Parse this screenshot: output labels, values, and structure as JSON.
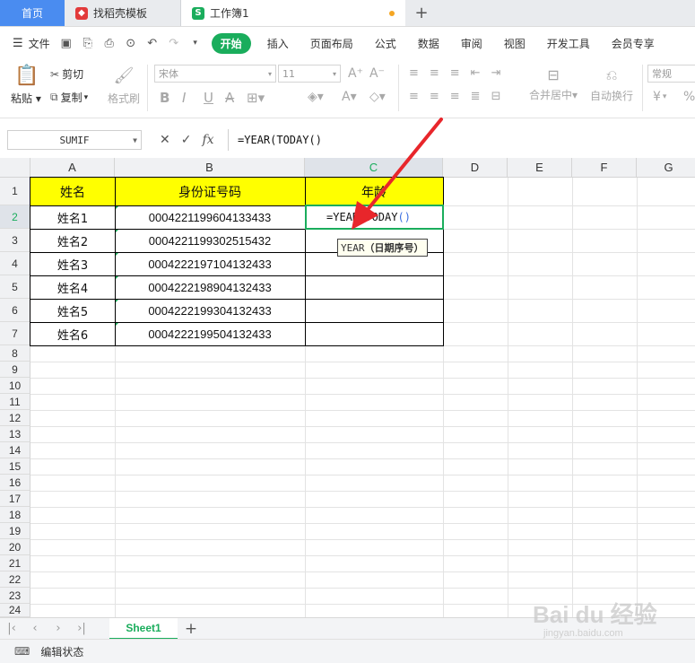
{
  "tabs": {
    "home": "首页",
    "daoke": "找稻壳模板",
    "workbook": "工作簿1",
    "add": "+"
  },
  "menu": {
    "file": "文件",
    "items": [
      "开始",
      "插入",
      "页面布局",
      "公式",
      "数据",
      "审阅",
      "视图",
      "开发工具",
      "会员专享"
    ]
  },
  "ribbon": {
    "paste": "粘贴",
    "cut": "剪切",
    "copy": "复制",
    "format_painter": "格式刷",
    "font_name": "宋体",
    "font_size": "11",
    "merge": "合并居中",
    "wrap": "自动换行",
    "number_format": "常规",
    "currency": "¥",
    "percent": "%",
    "bold": "B",
    "italic": "I",
    "underline": "U",
    "strike": "A"
  },
  "formula_bar": {
    "name_box": "SUMIF",
    "fx": "fx",
    "formula": "=YEAR(TODAY()"
  },
  "columns": [
    "A",
    "B",
    "C",
    "D",
    "E",
    "F",
    "G"
  ],
  "rows": [
    "1",
    "2",
    "3",
    "4",
    "5",
    "6",
    "7",
    "8",
    "9",
    "10",
    "11",
    "12",
    "13",
    "14",
    "15",
    "16",
    "17",
    "18",
    "19",
    "20",
    "21",
    "22",
    "23",
    "24"
  ],
  "table": {
    "headers": [
      "姓名",
      "身份证号码",
      "年龄"
    ],
    "data": [
      [
        "姓名1",
        "000422119960413343​3"
      ],
      [
        "姓名2",
        "0004221199302515432"
      ],
      [
        "姓名3",
        "0004222197104132433"
      ],
      [
        "姓名4",
        "0004222198904132433"
      ],
      [
        "姓名5",
        "0004222199304132433"
      ],
      [
        "姓名6",
        "0004222199504132433"
      ]
    ]
  },
  "active_cell": {
    "text_prefix": "=YEAR(",
    "text_func": "TODAY",
    "text_parens": "()"
  },
  "tooltip": {
    "func": "YEAR",
    "arg": "（日期序号）"
  },
  "sheets": [
    "Sheet1"
  ],
  "status": {
    "mode": "编辑状态"
  },
  "watermark": {
    "brand": "Bai du 经验",
    "url": "jingyan.baidu.com"
  }
}
